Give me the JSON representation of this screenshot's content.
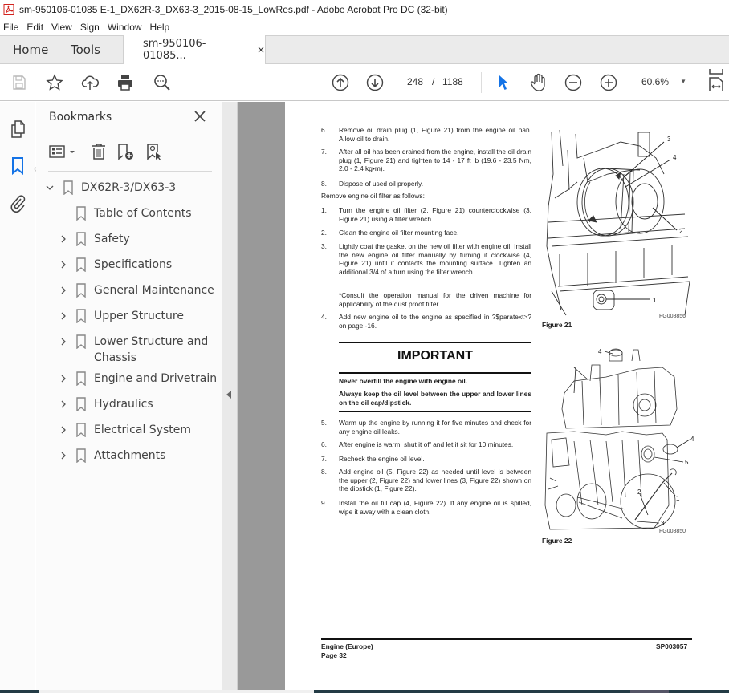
{
  "window": {
    "title": "sm-950106-01085 E-1_DX62R-3_DX63-3_2015-08-15_LowRes.pdf - Adobe Acrobat Pro DC (32-bit)"
  },
  "menu": [
    "File",
    "Edit",
    "View",
    "Sign",
    "Window",
    "Help"
  ],
  "tabs": {
    "home": "Home",
    "tools": "Tools",
    "document": "sm-950106-01085...",
    "close_glyph": "×"
  },
  "toolbar": {
    "icons": [
      "save-icon",
      "bookmark-star-icon",
      "upload-cloud-icon",
      "print-icon",
      "search-zoom-icon",
      "page-up-icon",
      "page-down-icon",
      "select-pointer-icon",
      "hand-icon",
      "zoom-out-icon",
      "zoom-in-icon",
      "fit-page-icon"
    ],
    "current_page": "248",
    "page_separator": "/",
    "total_pages": "1188",
    "zoom": "60.6%",
    "accent_color": "#1473e6"
  },
  "bookmarks_panel": {
    "title": "Bookmarks",
    "items": [
      {
        "label": "DX62R-3/DX63-3",
        "level": 0,
        "expanded": true
      },
      {
        "label": "Table of Contents",
        "level": 1,
        "expandable": false
      },
      {
        "label": "Safety",
        "level": 1,
        "expandable": true
      },
      {
        "label": "Specifications",
        "level": 1,
        "expandable": true
      },
      {
        "label": "General Maintenance",
        "level": 1,
        "expandable": true
      },
      {
        "label": "Upper Structure",
        "level": 1,
        "expandable": true
      },
      {
        "label": "Lower Structure and",
        "label2": "Chassis",
        "level": 1,
        "expandable": true
      },
      {
        "label": "Engine and Drivetrain",
        "level": 1,
        "expandable": true
      },
      {
        "label": "Hydraulics",
        "level": 1,
        "expandable": true
      },
      {
        "label": "Electrical System",
        "level": 1,
        "expandable": true
      },
      {
        "label": "Attachments",
        "level": 1,
        "expandable": true
      }
    ]
  },
  "document": {
    "steps_a": [
      {
        "num": "6.",
        "text": "Remove oil drain plug (1, Figure 21) from the engine oil pan. Allow oil to drain."
      },
      {
        "num": "7.",
        "text": "After all oil has been drained from the engine, install the oil drain plug (1, Figure 21) and tighten to 14 - 17 ft lb (19.6 - 23.5 Nm, 2.0 - 2.4 kg•m)."
      },
      {
        "num": "8.",
        "text": "Dispose of used oil properly."
      }
    ],
    "filter_intro": "Remove engine oil filter as follows:",
    "steps_b": [
      {
        "num": "1.",
        "text": "Turn the engine oil filter (2, Figure 21) counterclockwise (3, Figure 21) using a filter wrench."
      },
      {
        "num": "2.",
        "text": "Clean the engine oil filter mounting face."
      },
      {
        "num": "3.",
        "text": "Lightly coat the gasket on the new oil filter with engine oil. Install the new engine oil filter manually by turning it clockwise (4, Figure 21) until it contacts the mounting surface. Tighten an additional 3/4 of a turn using the filter wrench."
      },
      {
        "num": "",
        "text": "*Consult the operation manual for the driven machine for applicability of the dust proof filter."
      },
      {
        "num": "4.",
        "text": "Add new engine oil to the engine as specified in ?$paratext>? on page -16."
      }
    ],
    "important": {
      "title": "IMPORTANT",
      "line1": "Never overfill the engine with engine oil.",
      "line2": "Always keep the oil level between the upper and lower lines on the oil cap/dipstick."
    },
    "steps_c": [
      {
        "num": "5.",
        "text": "Warm up the engine by running it for five minutes and check for any engine oil leaks."
      },
      {
        "num": "6.",
        "text": "After engine is warm, shut it off and let it sit for 10 minutes."
      },
      {
        "num": "7.",
        "text": "Recheck the engine oil level."
      },
      {
        "num": "8.",
        "text": "Add engine oil (5, Figure 22) as needed until level is between the upper (2, Figure 22) and lower lines (3, Figure 22) shown on the dipstick (1, Figure 22)."
      },
      {
        "num": "9.",
        "text": "Install the oil fill cap (4, Figure 22). If any engine oil is spilled, wipe it away with a clean cloth."
      }
    ],
    "figure21": {
      "caption": "Figure 21",
      "code": "FG008856",
      "callouts": [
        "1",
        "2",
        "3",
        "4"
      ]
    },
    "figure22": {
      "caption": "Figure 22",
      "code": "FG008850",
      "callouts": [
        "1",
        "2",
        "3",
        "4",
        "4",
        "5"
      ]
    },
    "footer": {
      "section": "Engine (Europe)",
      "page": "Page 32",
      "doc_code": "SP003057"
    }
  }
}
